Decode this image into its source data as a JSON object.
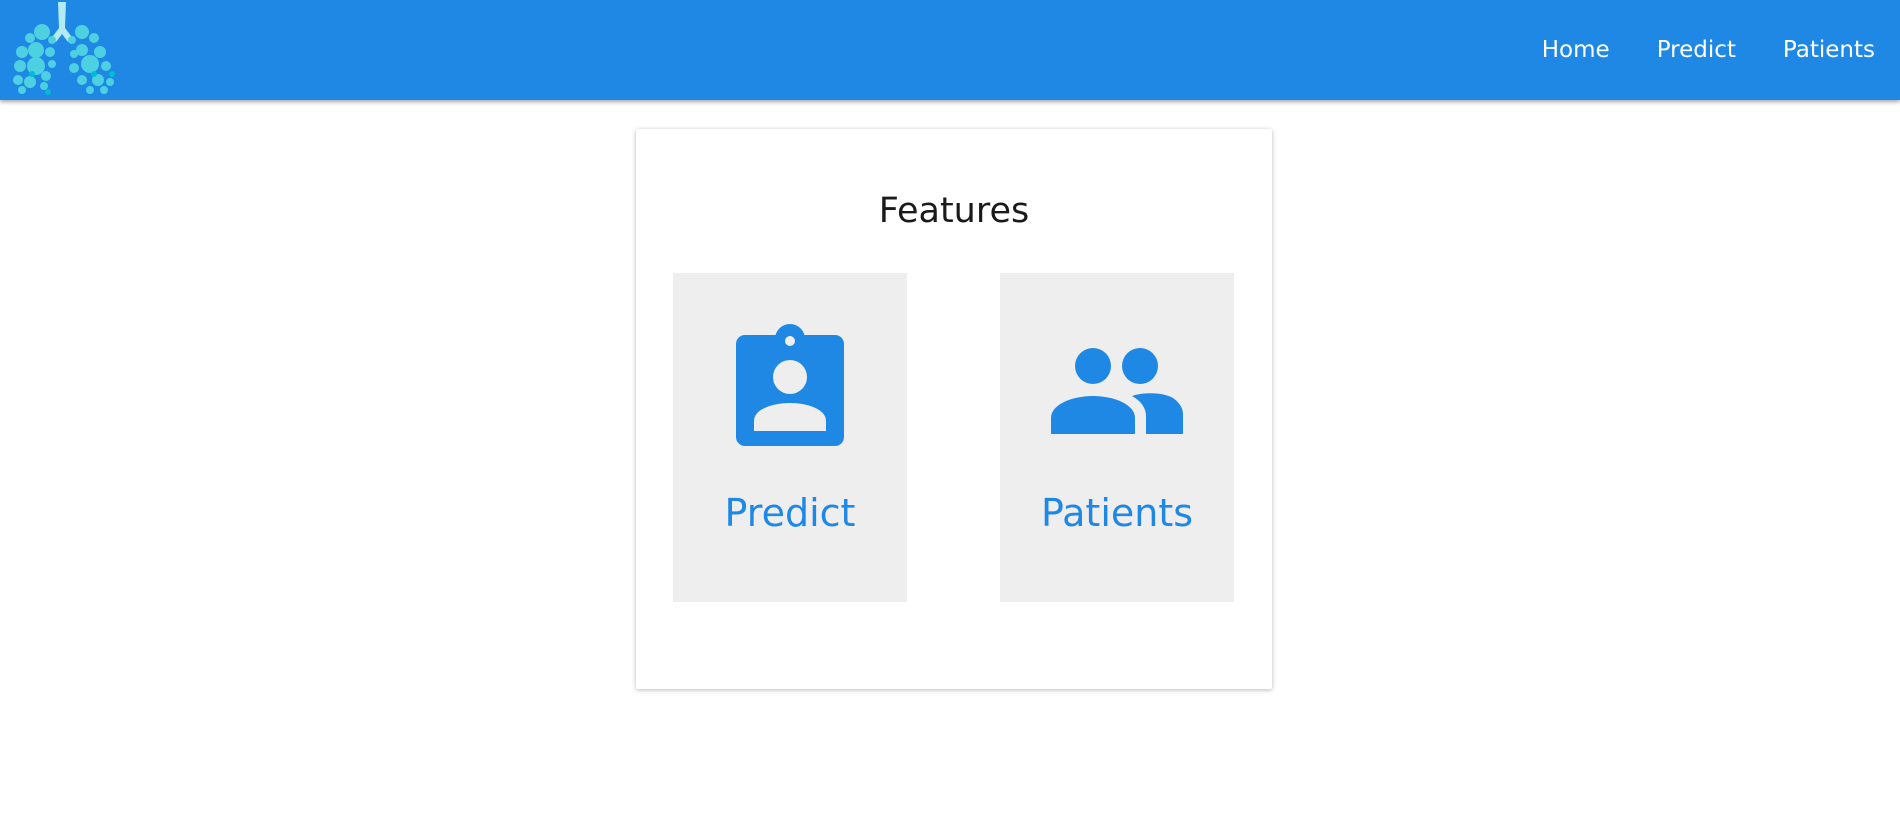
{
  "nav": {
    "logo_icon": "lungs-icon",
    "links": [
      "Home",
      "Predict",
      "Patients"
    ]
  },
  "features": {
    "title": "Features",
    "items": [
      {
        "label": "Predict",
        "icon": "badge-person-icon"
      },
      {
        "label": "Patients",
        "icon": "people-icon"
      }
    ]
  },
  "colors": {
    "primary": "#1f88e5",
    "logo": "#4dd0e1",
    "tile": "#eeeeee"
  }
}
